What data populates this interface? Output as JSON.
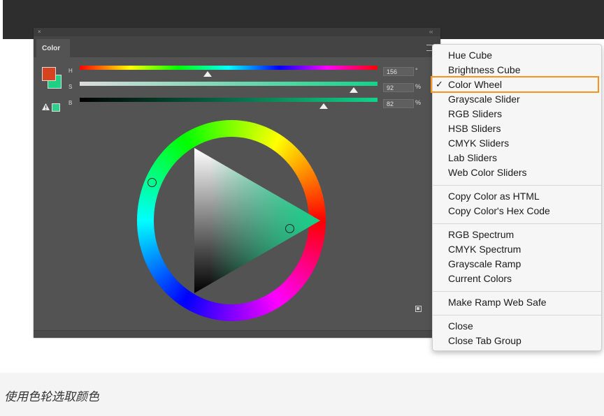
{
  "panel": {
    "title_close": "×",
    "collapse": "‹‹",
    "tab_label": "Color",
    "menu_icon": "hamburger-icon",
    "sliders": [
      {
        "label": "H",
        "value": "156",
        "unit": "°",
        "level": 0.43
      },
      {
        "label": "S",
        "value": "92",
        "unit": "%",
        "level": 0.92
      },
      {
        "label": "B",
        "value": "82",
        "unit": "%",
        "level": 0.82
      }
    ],
    "colors": {
      "foreground": "#d6431e",
      "background": "#1fd184",
      "gamut_swatch": "#2ecf8a",
      "selected": "#12d38a"
    },
    "warning_icon": "gamut-warning-icon",
    "resize_icon": "resize-grip-icon"
  },
  "menu": {
    "groups": [
      [
        "Hue Cube",
        "Brightness Cube",
        "Color Wheel",
        "Grayscale Slider",
        "RGB Sliders",
        "HSB Sliders",
        "CMYK Sliders",
        "Lab Sliders",
        "Web Color Sliders"
      ],
      [
        "Copy Color as HTML",
        "Copy Color's Hex Code"
      ],
      [
        "RGB Spectrum",
        "CMYK Spectrum",
        "Grayscale Ramp",
        "Current Colors"
      ],
      [
        "Make Ramp Web Safe"
      ],
      [
        "Close",
        "Close Tab Group"
      ]
    ],
    "checked_item": "Color Wheel",
    "check_mark": "✓",
    "highlight_color": "#f7941d"
  },
  "caption": "使用色轮选取颜色"
}
